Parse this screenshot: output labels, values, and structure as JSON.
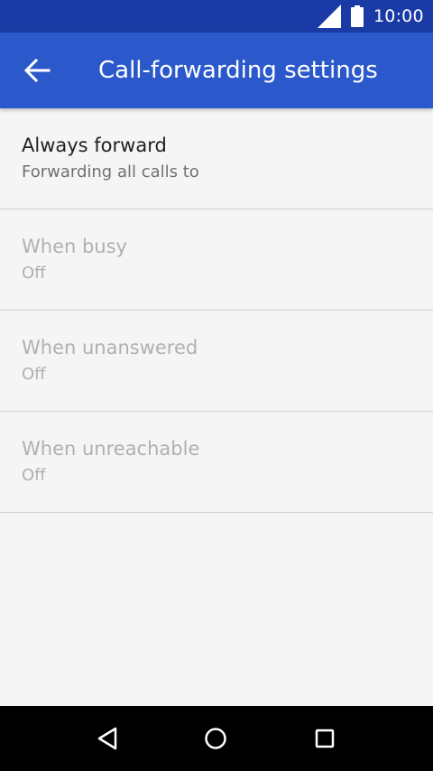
{
  "status_bar": {
    "time": "10:00",
    "icons": [
      "signal-icon",
      "battery-icon"
    ]
  },
  "app_bar": {
    "title": "Call-forwarding settings",
    "back_icon": "arrow-left-icon"
  },
  "settings": [
    {
      "title": "Always forward",
      "summary": "Forwarding all calls to",
      "enabled": true
    },
    {
      "title": "When busy",
      "summary": "Off",
      "enabled": false
    },
    {
      "title": "When unanswered",
      "summary": "Off",
      "enabled": false
    },
    {
      "title": "When unreachable",
      "summary": "Off",
      "enabled": false
    }
  ],
  "nav_bar": {
    "icons": [
      "nav-back-icon",
      "nav-home-icon",
      "nav-recents-icon"
    ]
  },
  "colors": {
    "status_bar": "#1a3aa6",
    "app_bar": "#2b59cc",
    "background": "#f5f5f5",
    "text_primary": "#212121",
    "text_secondary": "#707070",
    "text_disabled": "#b0b0b0",
    "divider": "#d0d0d0"
  }
}
